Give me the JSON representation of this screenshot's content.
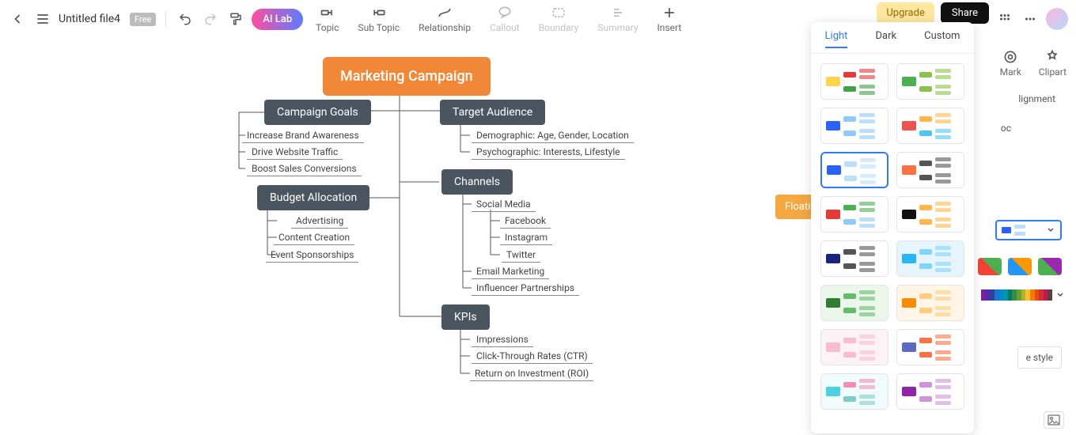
{
  "header": {
    "file_name": "Untitled file4",
    "free_badge": "Free",
    "ai_lab": "AI Lab",
    "upgrade": "Upgrade",
    "share": "Share"
  },
  "tools": {
    "topic": "Topic",
    "subtopic": "Sub Topic",
    "relationship": "Relationship",
    "callout": "Callout",
    "boundary": "Boundary",
    "summary": "Summary",
    "insert": "Insert"
  },
  "right_icons": {
    "mark": "Mark",
    "clipart": "Clipart"
  },
  "right_panel": {
    "alignment_frag": "lignment",
    "oc_frag": "oc",
    "more_style": "e style"
  },
  "theme": {
    "tabs": {
      "light": "Light",
      "dark": "Dark",
      "custom": "Custom"
    }
  },
  "mindmap": {
    "root": "Marketing Campaign",
    "floating": "Floati",
    "branches": [
      {
        "title": "Campaign Goals",
        "leaves": [
          "Increase Brand Awareness",
          "Drive Website Traffic",
          "Boost Sales Conversions"
        ]
      },
      {
        "title": "Target Audience",
        "leaves": [
          "Demographic: Age, Gender, Location",
          "Psychographic: Interests, Lifestyle"
        ]
      },
      {
        "title": "Channels",
        "leaves": [
          "Social Media",
          "Facebook",
          "Instagram",
          "Twitter",
          "Email Marketing",
          "Influencer Partnerships"
        ]
      },
      {
        "title": "Budget Allocation",
        "leaves": [
          "Advertising",
          "Content Creation",
          "Event Sponsorships"
        ]
      },
      {
        "title": "KPIs",
        "leaves": [
          "Impressions",
          "Click-Through Rates (CTR)",
          "Return on Investment (ROI)"
        ]
      }
    ]
  },
  "theme_thumbs": [
    {
      "root": "#ffd54a",
      "c1": "#e53935",
      "c2": "#43a047"
    },
    {
      "root": "#4caf50",
      "c1": "#8bc34a",
      "c2": "#8bc34a"
    },
    {
      "root": "#2962ff",
      "c1": "#90caf9",
      "c2": "#90caf9"
    },
    {
      "root": "#ef5350",
      "c1": "#ffb74d",
      "c2": "#4fc3f7"
    },
    {
      "root": "#2962ff",
      "c1": "#bbdefb",
      "c2": "#bbdefb",
      "selected": true
    },
    {
      "root": "#ff7043",
      "c1": "#555",
      "c2": "#555"
    },
    {
      "root": "#e53935",
      "c1": "#4caf50",
      "c2": "#90caf9"
    },
    {
      "root": "#111",
      "c1": "#ffb74d",
      "c2": "#ffb74d"
    },
    {
      "root": "#1a237e",
      "c1": "#555",
      "c2": "#555"
    },
    {
      "root": "#29b6f6",
      "c1": "#81d4fa",
      "c2": "#81d4fa",
      "bg": "#e6f5fd"
    },
    {
      "root": "#2e7d32",
      "c1": "#66bb6a",
      "c2": "#66bb6a",
      "bg": "#ecf7ec"
    },
    {
      "root": "#fb8c00",
      "c1": "#ffcc80",
      "c2": "#ffcc80",
      "bg": "#fff6e8"
    },
    {
      "root": "#f8bbd0",
      "c1": "#f8bbd0",
      "c2": "#f8bbd0",
      "bg": "#fdf2f6"
    },
    {
      "root": "#5c6bc0",
      "c1": "#ff7043",
      "c2": "#ff7043"
    },
    {
      "root": "#4dd0e1",
      "c1": "#f48fb1",
      "c2": "#80cbc4",
      "bg": "#f0fbfc"
    },
    {
      "root": "#8e24aa",
      "c1": "#ce93d8",
      "c2": "#ce93d8"
    }
  ],
  "color_strip": [
    "#7b1fa2",
    "#512da8",
    "#303f9f",
    "#1976d2",
    "#0288d1",
    "#0097a7",
    "#00796b",
    "#388e3c",
    "#689f38",
    "#afb42b",
    "#fbc02d",
    "#f57c00",
    "#e64a19",
    "#d32f2f",
    "#c2185b",
    "#5d4037"
  ]
}
